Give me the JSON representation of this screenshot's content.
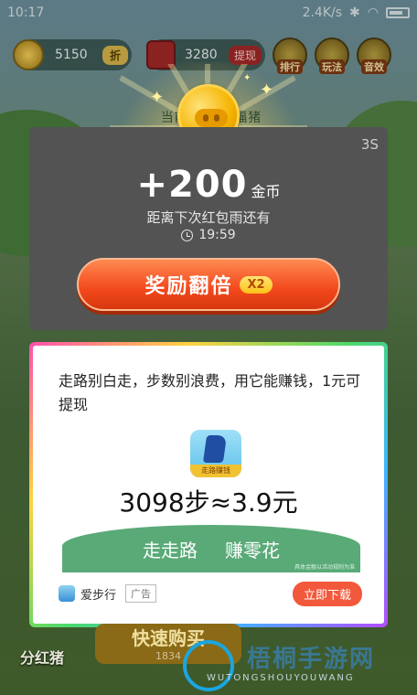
{
  "statusbar": {
    "time": "10:17",
    "speed": "2.4K/s"
  },
  "topbar": {
    "coins": "5150",
    "coin_tag": "折",
    "redpacket": "3280",
    "withdraw_tag": "提现",
    "btn_rank": "排行",
    "btn_play": "玩法",
    "btn_music": "音效"
  },
  "behind_text": "当前等级 福福猪",
  "reward": {
    "timer": "3S",
    "amount": "+200",
    "unit": "金币",
    "subtitle": "距离下次红包雨还有",
    "countdown": "19:59",
    "double_label": "奖励翻倍",
    "double_badge": "X2"
  },
  "ad": {
    "text": "走路别白走，步数别浪费，用它能赚钱，1元可提现",
    "app_label": "走路赚钱",
    "steps": "3098步≈3.9元",
    "banner_left": "走走路",
    "banner_right": "赚零花",
    "banner_tiny": "具体金额以活动规则为准",
    "brand": "爱步行",
    "ad_badge": "广告",
    "download": "立即下载"
  },
  "bottom": {
    "fenhong": "分红猪",
    "middle": "快速购买",
    "middle_sub": "1834",
    "watermark": "梧桐手游网",
    "watermark_sub": "WUTONGSHOUYOUWANG"
  }
}
